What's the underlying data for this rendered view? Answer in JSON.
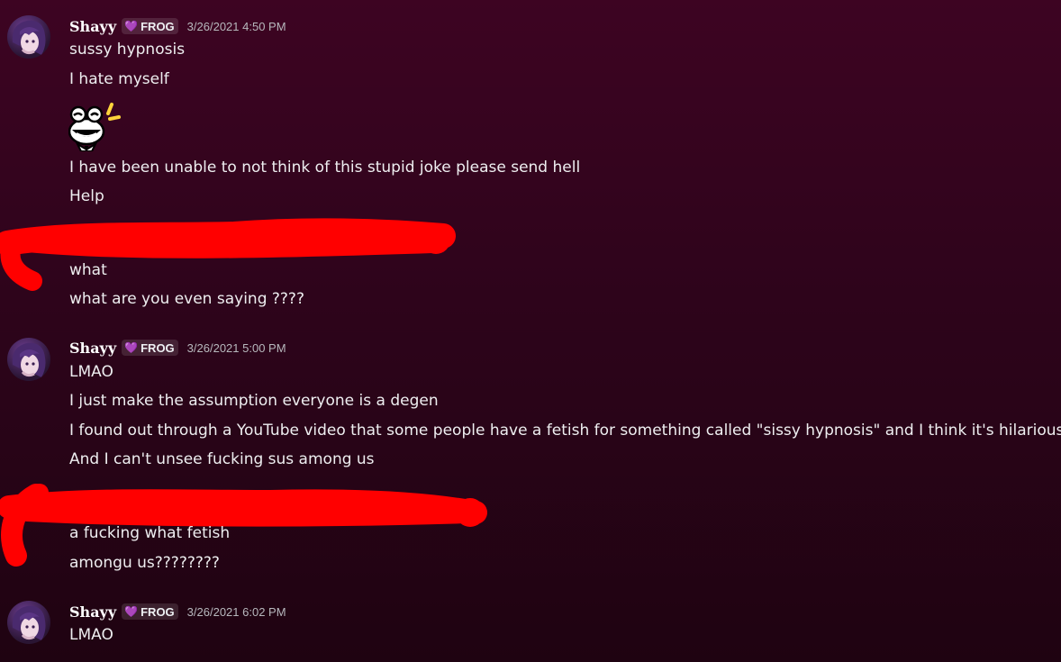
{
  "groups": [
    {
      "username": "Shayy",
      "tag": "FROG",
      "timestamp": "3/26/2021 4:50 PM",
      "messages": [
        "sussy hypnosis",
        "I hate myself"
      ]
    },
    {
      "messages_after_sticker": [
        "I have been unable to not think of this stupid joke please send hell",
        "Help"
      ],
      "sticker_icon": "frog-emoji-icon"
    },
    {
      "messages": [
        "what",
        "what are you even saying ????"
      ]
    },
    {
      "username": "Shayy",
      "tag": "FROG",
      "timestamp": "3/26/2021 5:00 PM",
      "messages": [
        "LMAO",
        "I just make the assumption everyone is a degen",
        "I found out through a YouTube video that some people have a fetish for something called \"sissy hypnosis\" and I think it's hilarious",
        "And I can't unsee fucking sus among us"
      ]
    },
    {
      "messages": [
        "a fucking what fetish",
        "amongu us????????"
      ]
    },
    {
      "username": "Shayy",
      "tag": "FROG",
      "timestamp": "3/26/2021 6:02 PM",
      "messages": [
        "LMAO"
      ]
    }
  ],
  "colors": {
    "background_top": "#3d0422",
    "background_bottom": "#1f0311",
    "redaction": "#ff0000",
    "tag_heart": "#c9a2f0"
  }
}
